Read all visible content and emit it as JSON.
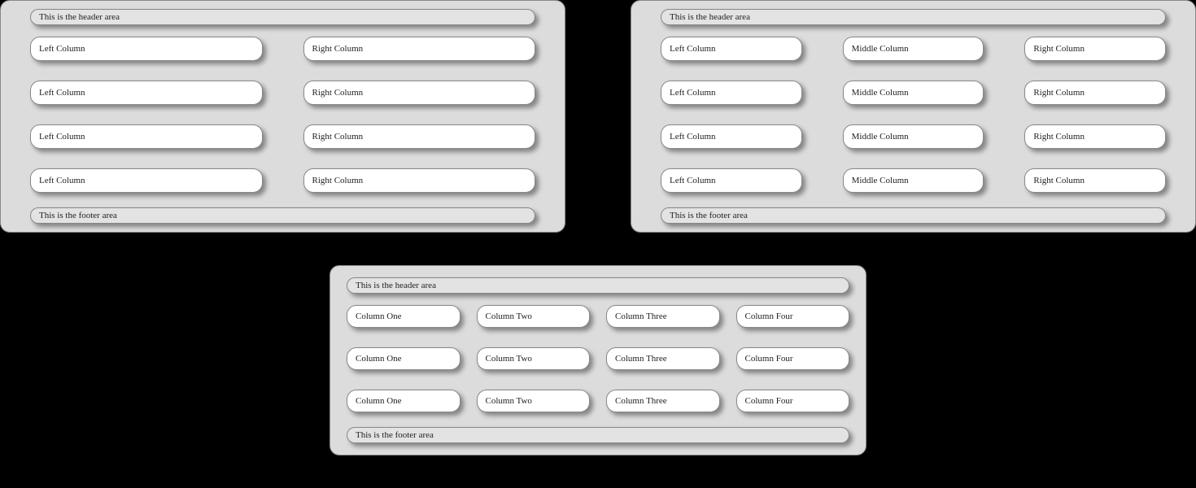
{
  "common": {
    "header": "This is the header area",
    "footer": "This is the footer area"
  },
  "panel_a": {
    "rows": [
      {
        "left": "Left Column",
        "right": "Right Column"
      },
      {
        "left": "Left Column",
        "right": "Right Column"
      },
      {
        "left": "Left Column",
        "right": "Right Column"
      },
      {
        "left": "Left Column",
        "right": "Right Column"
      }
    ]
  },
  "panel_b": {
    "rows": [
      {
        "left": "Left Column",
        "middle": "Middle Column",
        "right": "Right Column"
      },
      {
        "left": "Left Column",
        "middle": "Middle Column",
        "right": "Right Column"
      },
      {
        "left": "Left Column",
        "middle": "Middle Column",
        "right": "Right Column"
      },
      {
        "left": "Left Column",
        "middle": "Middle Column",
        "right": "Right Column"
      }
    ]
  },
  "panel_c": {
    "rows": [
      {
        "c1": "Column One",
        "c2": "Column Two",
        "c3": "Column Three",
        "c4": "Column Four"
      },
      {
        "c1": "Column One",
        "c2": "Column Two",
        "c3": "Column Three",
        "c4": "Column Four"
      },
      {
        "c1": "Column One",
        "c2": "Column Two",
        "c3": "Column Three",
        "c4": "Column Four"
      }
    ]
  }
}
